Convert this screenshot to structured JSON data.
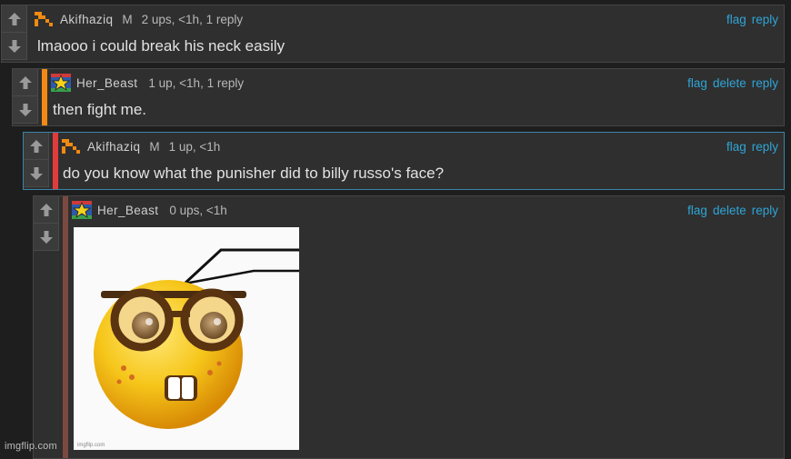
{
  "comments": [
    {
      "user": "Akifhaziq",
      "badge": "M",
      "meta": "2 ups, <1h, 1 reply",
      "actions": [
        "flag",
        "reply"
      ],
      "text": "lmaooo i could break his neck easily"
    },
    {
      "user": "Her_Beast",
      "badge": "",
      "meta": "1 up, <1h, 1 reply",
      "actions": [
        "flag",
        "delete",
        "reply"
      ],
      "text": "then fight me."
    },
    {
      "user": "Akifhaziq",
      "badge": "M",
      "meta": "1 up, <1h",
      "actions": [
        "flag",
        "reply"
      ],
      "text": "do you know what the punisher did to billy russo's face?"
    },
    {
      "user": "Her_Beast",
      "badge": "",
      "meta": "0 ups, <1h",
      "actions": [
        "flag",
        "delete",
        "reply"
      ],
      "image": "nerd-emoji-with-glasses",
      "image_caption": "imgflip.com"
    }
  ],
  "watermark": "imgflip.com",
  "colors": {
    "bar_orange": "#f08a12",
    "bar_red": "#e23b3b",
    "bar_brown": "#7a4a40",
    "link": "#2fa5d6",
    "highlight_border": "#3a84a6"
  }
}
